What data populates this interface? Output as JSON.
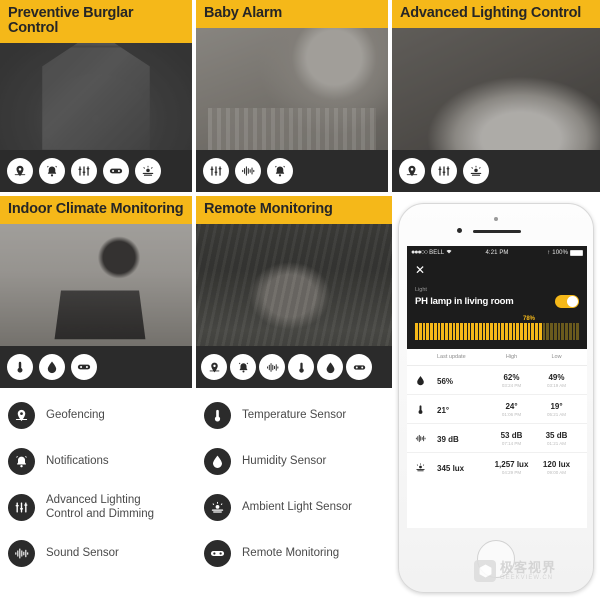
{
  "accent_color": "#f5b819",
  "dark_color": "#2b2b2b",
  "cards": [
    {
      "title": "Preventive Burglar Control",
      "photo": "ph-house",
      "icons": [
        "geofencing-icon",
        "notifications-icon",
        "lighting-icon",
        "remote-monitoring-icon",
        "ambient-light-icon"
      ]
    },
    {
      "title": "Baby Alarm",
      "photo": "ph-baby",
      "icons": [
        "lighting-icon",
        "sound-sensor-icon",
        "notifications-icon"
      ]
    },
    {
      "title": "Advanced Lighting Control",
      "photo": "ph-popcorn",
      "icons": [
        "geofencing-icon",
        "lighting-icon",
        "ambient-light-icon"
      ]
    },
    {
      "title": "Indoor Climate Monitoring",
      "photo": "ph-office",
      "icons": [
        "temperature-icon",
        "humidity-icon",
        "remote-monitoring-icon"
      ]
    },
    {
      "title": "Remote Monitoring",
      "photo": "ph-forest",
      "icons": [
        "geofencing-icon",
        "notifications-icon",
        "sound-sensor-icon",
        "temperature-icon",
        "humidity-icon",
        "remote-monitoring-icon"
      ]
    }
  ],
  "legend": {
    "left": [
      {
        "icon": "geofencing-icon",
        "label": "Geofencing"
      },
      {
        "icon": "notifications-icon",
        "label": "Notifications"
      },
      {
        "icon": "lighting-icon",
        "label": "Advanced Lighting\nControl and Dimming"
      },
      {
        "icon": "sound-sensor-icon",
        "label": "Sound Sensor"
      }
    ],
    "right": [
      {
        "icon": "temperature-icon",
        "label": "Temperature Sensor"
      },
      {
        "icon": "humidity-icon",
        "label": "Humidity Sensor"
      },
      {
        "icon": "ambient-light-icon",
        "label": "Ambient Light Sensor"
      },
      {
        "icon": "remote-monitoring-icon",
        "label": "Remote Monitoring"
      }
    ]
  },
  "phone": {
    "statusbar": {
      "signal_dots": "●●●○○",
      "carrier": "BELL",
      "wifi": "wifi-icon",
      "time": "4:21 PM",
      "lock": "↑",
      "battery_pct": "100%"
    },
    "app": {
      "close_label": "✕",
      "category": "Light",
      "device_name": "PH lamp in living room",
      "toggle_state": "on",
      "brightness_pct": "78%",
      "brightness_value": 78
    },
    "table": {
      "headers": [
        "Last update",
        "High",
        "Low"
      ],
      "rows": [
        {
          "icon": "humidity-icon",
          "last": "56%",
          "high": "62%",
          "high_time": "03:24 PM",
          "low": "49%",
          "low_time": "03:19 AM"
        },
        {
          "icon": "temperature-icon",
          "last": "21°",
          "high": "24°",
          "high_time": "01:06 PM",
          "low": "19°",
          "low_time": "05:21 AM"
        },
        {
          "icon": "sound-sensor-icon",
          "last": "39 dB",
          "high": "53 dB",
          "high_time": "07:14 PM",
          "low": "35 dB",
          "low_time": "01:21 AM"
        },
        {
          "icon": "ambient-light-icon",
          "last": "345 lux",
          "high": "1,257 lux",
          "high_time": "04:29 PM",
          "low": "120 lux",
          "low_time": "09:00 AM"
        }
      ]
    }
  },
  "watermark": {
    "cn": "极客视界",
    "en": "GEEKVIEW.CN"
  }
}
